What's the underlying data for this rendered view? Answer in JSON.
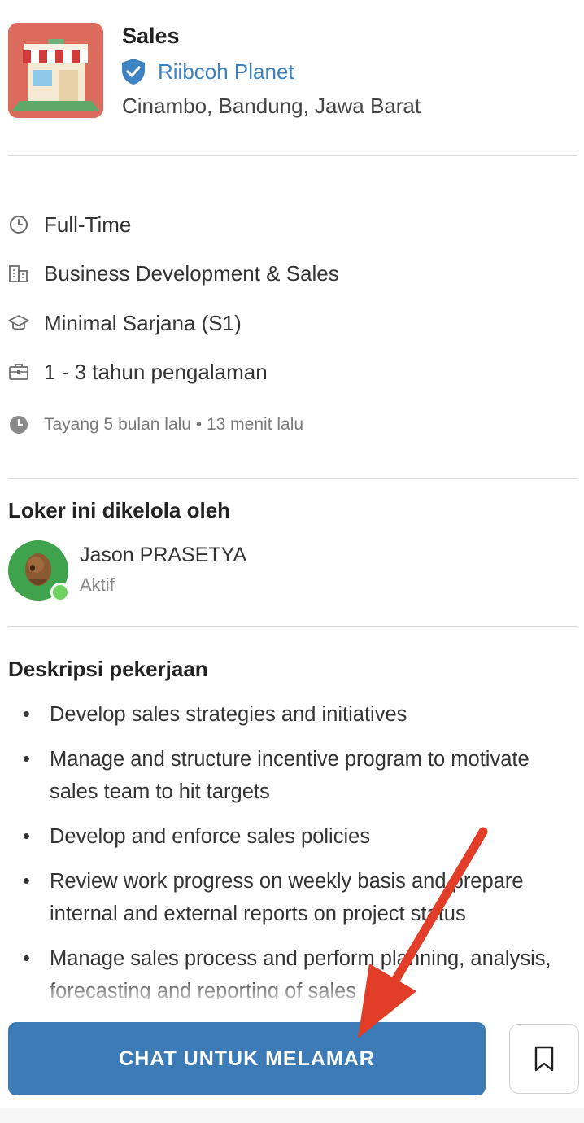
{
  "job": {
    "title": "Sales",
    "company": "Riibcoh Planet",
    "location": "Cinambo, Bandung, Jawa Barat"
  },
  "details": {
    "employment_type": "Full-Time",
    "category": "Business Development & Sales",
    "education": "Minimal Sarjana (S1)",
    "experience": "1 - 3 tahun pengalaman",
    "posted": "Tayang 5 bulan lalu • 13 menit lalu"
  },
  "recruiter_section": {
    "title": "Loker ini dikelola oleh",
    "name": "Jason PRASETYA",
    "status": "Aktif"
  },
  "description": {
    "title": "Deskripsi pekerjaan",
    "items": [
      "Develop sales strategies and initiatives",
      "Manage and structure incentive program to motivate sales team to hit targets",
      "Develop and enforce sales policies",
      "Review work progress on weekly basis and prepare internal and external reports on project status",
      "Manage sales process and perform planning, analysis, forecasting and reporting of sales"
    ]
  },
  "actions": {
    "apply_label": "CHAT UNTUK MELAMAR"
  },
  "colors": {
    "accent": "#3c7bb5",
    "link": "#3d82c1",
    "annotation_arrow": "#e23d28"
  }
}
